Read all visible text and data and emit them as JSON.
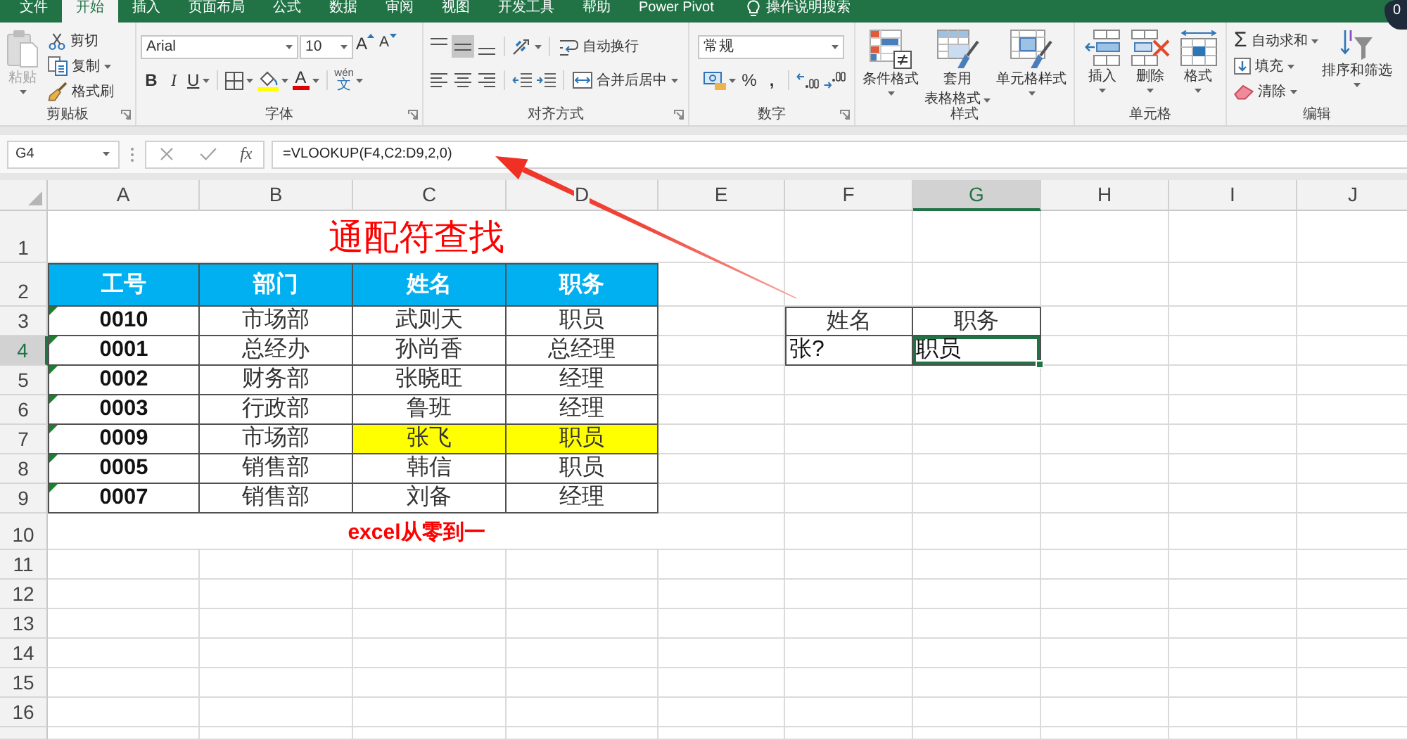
{
  "tabs": [
    {
      "label": "文件",
      "selected": false
    },
    {
      "label": "开始",
      "selected": true
    },
    {
      "label": "插入",
      "selected": false
    },
    {
      "label": "页面布局",
      "selected": false
    },
    {
      "label": "公式",
      "selected": false
    },
    {
      "label": "数据",
      "selected": false
    },
    {
      "label": "审阅",
      "selected": false
    },
    {
      "label": "视图",
      "selected": false
    },
    {
      "label": "开发工具",
      "selected": false
    },
    {
      "label": "帮助",
      "selected": false
    },
    {
      "label": "Power Pivot",
      "selected": false
    }
  ],
  "tell_me": "操作说明搜索",
  "corner_badge": "0",
  "ribbon": {
    "clipboard": {
      "label": "剪贴板",
      "paste": {
        "label": "粘贴",
        "disabled": true
      },
      "buttons": [
        {
          "kind": "cut",
          "label": "剪切",
          "dropdown": false
        },
        {
          "kind": "copy",
          "label": "复制",
          "dropdown": true
        },
        {
          "kind": "format_painter",
          "label": "格式刷",
          "dropdown": false
        }
      ]
    },
    "font": {
      "label": "字体",
      "font_name": "Arial",
      "font_size": "10",
      "grow": "A",
      "shrink": "A",
      "bold": "B",
      "italic": "I",
      "underline": "U",
      "font_color": "A",
      "phonetic": {
        "top": "wén",
        "bottom": "文"
      }
    },
    "alignment": {
      "label": "对齐方式",
      "align_buttons": [
        {
          "kind": "top",
          "selected": false
        },
        {
          "kind": "middle",
          "selected": true
        },
        {
          "kind": "bottom",
          "selected": false
        },
        {
          "kind": "left",
          "selected": false
        },
        {
          "kind": "center",
          "selected": false
        },
        {
          "kind": "right",
          "selected": false
        }
      ],
      "wrap_text": "自动换行",
      "merge_center": "合并后居中"
    },
    "number": {
      "label": "数字",
      "format": "常规",
      "percent": "%",
      "comma": ","
    },
    "styles": {
      "label": "样式",
      "items": [
        {
          "kind": "conditional",
          "lines": [
            "条件格式"
          ]
        },
        {
          "kind": "table",
          "lines": [
            "套用",
            "表格格式"
          ]
        },
        {
          "kind": "cell_style",
          "lines": [
            "单元格样式"
          ]
        }
      ]
    },
    "cells": {
      "label": "单元格",
      "items": [
        {
          "kind": "insert",
          "label": "插入"
        },
        {
          "kind": "delete",
          "label": "删除"
        },
        {
          "kind": "format",
          "label": "格式"
        }
      ]
    },
    "editing": {
      "label": "编辑",
      "buttons": [
        {
          "kind": "autosum",
          "symbol": "Σ",
          "label": "自动求和"
        },
        {
          "kind": "fill",
          "label": "填充"
        },
        {
          "kind": "clear",
          "label": "清除"
        }
      ],
      "sort_filter": "排序和筛选"
    }
  },
  "formula_bar": {
    "name_box": "G4",
    "function_label": "fx",
    "formula": "=VLOOKUP(F4,C2:D9,2,0)"
  },
  "sheet": {
    "columns": [
      {
        "label": "A",
        "selected": false
      },
      {
        "label": "B",
        "selected": false
      },
      {
        "label": "C",
        "selected": false
      },
      {
        "label": "D",
        "selected": false
      },
      {
        "label": "E",
        "selected": false
      },
      {
        "label": "F",
        "selected": false
      },
      {
        "label": "G",
        "selected": true
      },
      {
        "label": "H",
        "selected": false
      },
      {
        "label": "I",
        "selected": false
      },
      {
        "label": "J",
        "selected": false
      }
    ],
    "rows": [
      {
        "label": "1",
        "selected": false
      },
      {
        "label": "2",
        "selected": false
      },
      {
        "label": "3",
        "selected": false
      },
      {
        "label": "4",
        "selected": true
      },
      {
        "label": "5",
        "selected": false
      },
      {
        "label": "6",
        "selected": false
      },
      {
        "label": "7",
        "selected": false
      },
      {
        "label": "8",
        "selected": false
      },
      {
        "label": "9",
        "selected": false
      },
      {
        "label": "10",
        "selected": false
      },
      {
        "label": "11",
        "selected": false
      },
      {
        "label": "12",
        "selected": false
      },
      {
        "label": "13",
        "selected": false
      },
      {
        "label": "14",
        "selected": false
      },
      {
        "label": "15",
        "selected": false
      },
      {
        "label": "16",
        "selected": false
      }
    ],
    "title": "通配符查找",
    "table": {
      "header": [
        "工号",
        "部门",
        "姓名",
        "职务"
      ],
      "rows": [
        {
          "cells": [
            {
              "text": "0010",
              "flagged": true,
              "highlighted": false
            },
            {
              "text": "市场部",
              "flagged": false,
              "highlighted": false
            },
            {
              "text": "武则天",
              "flagged": false,
              "highlighted": false
            },
            {
              "text": "职员",
              "flagged": false,
              "highlighted": false
            }
          ]
        },
        {
          "cells": [
            {
              "text": "0001",
              "flagged": true,
              "highlighted": false
            },
            {
              "text": "总经办",
              "flagged": false,
              "highlighted": false
            },
            {
              "text": "孙尚香",
              "flagged": false,
              "highlighted": false
            },
            {
              "text": "总经理",
              "flagged": false,
              "highlighted": false
            }
          ]
        },
        {
          "cells": [
            {
              "text": "0002",
              "flagged": true,
              "highlighted": false
            },
            {
              "text": "财务部",
              "flagged": false,
              "highlighted": false
            },
            {
              "text": "张晓旺",
              "flagged": false,
              "highlighted": false
            },
            {
              "text": "经理",
              "flagged": false,
              "highlighted": false
            }
          ]
        },
        {
          "cells": [
            {
              "text": "0003",
              "flagged": true,
              "highlighted": false
            },
            {
              "text": "行政部",
              "flagged": false,
              "highlighted": false
            },
            {
              "text": "鲁班",
              "flagged": false,
              "highlighted": false
            },
            {
              "text": "经理",
              "flagged": false,
              "highlighted": false
            }
          ]
        },
        {
          "cells": [
            {
              "text": "0009",
              "flagged": true,
              "highlighted": false
            },
            {
              "text": "市场部",
              "flagged": false,
              "highlighted": false
            },
            {
              "text": "张飞",
              "flagged": false,
              "highlighted": true
            },
            {
              "text": "职员",
              "flagged": false,
              "highlighted": true
            }
          ]
        },
        {
          "cells": [
            {
              "text": "0005",
              "flagged": true,
              "highlighted": false
            },
            {
              "text": "销售部",
              "flagged": false,
              "highlighted": false
            },
            {
              "text": "韩信",
              "flagged": false,
              "highlighted": false
            },
            {
              "text": "职员",
              "flagged": false,
              "highlighted": false
            }
          ]
        },
        {
          "cells": [
            {
              "text": "0007",
              "flagged": true,
              "highlighted": false
            },
            {
              "text": "销售部",
              "flagged": false,
              "highlighted": false
            },
            {
              "text": "刘备",
              "flagged": false,
              "highlighted": false
            },
            {
              "text": "经理",
              "flagged": false,
              "highlighted": false
            }
          ]
        }
      ]
    },
    "note": "excel从零到一",
    "lookup": {
      "header": [
        "姓名",
        "职务"
      ],
      "cells": [
        {
          "text": "张?",
          "selected": false
        },
        {
          "text": "职员",
          "selected": true
        }
      ]
    }
  }
}
